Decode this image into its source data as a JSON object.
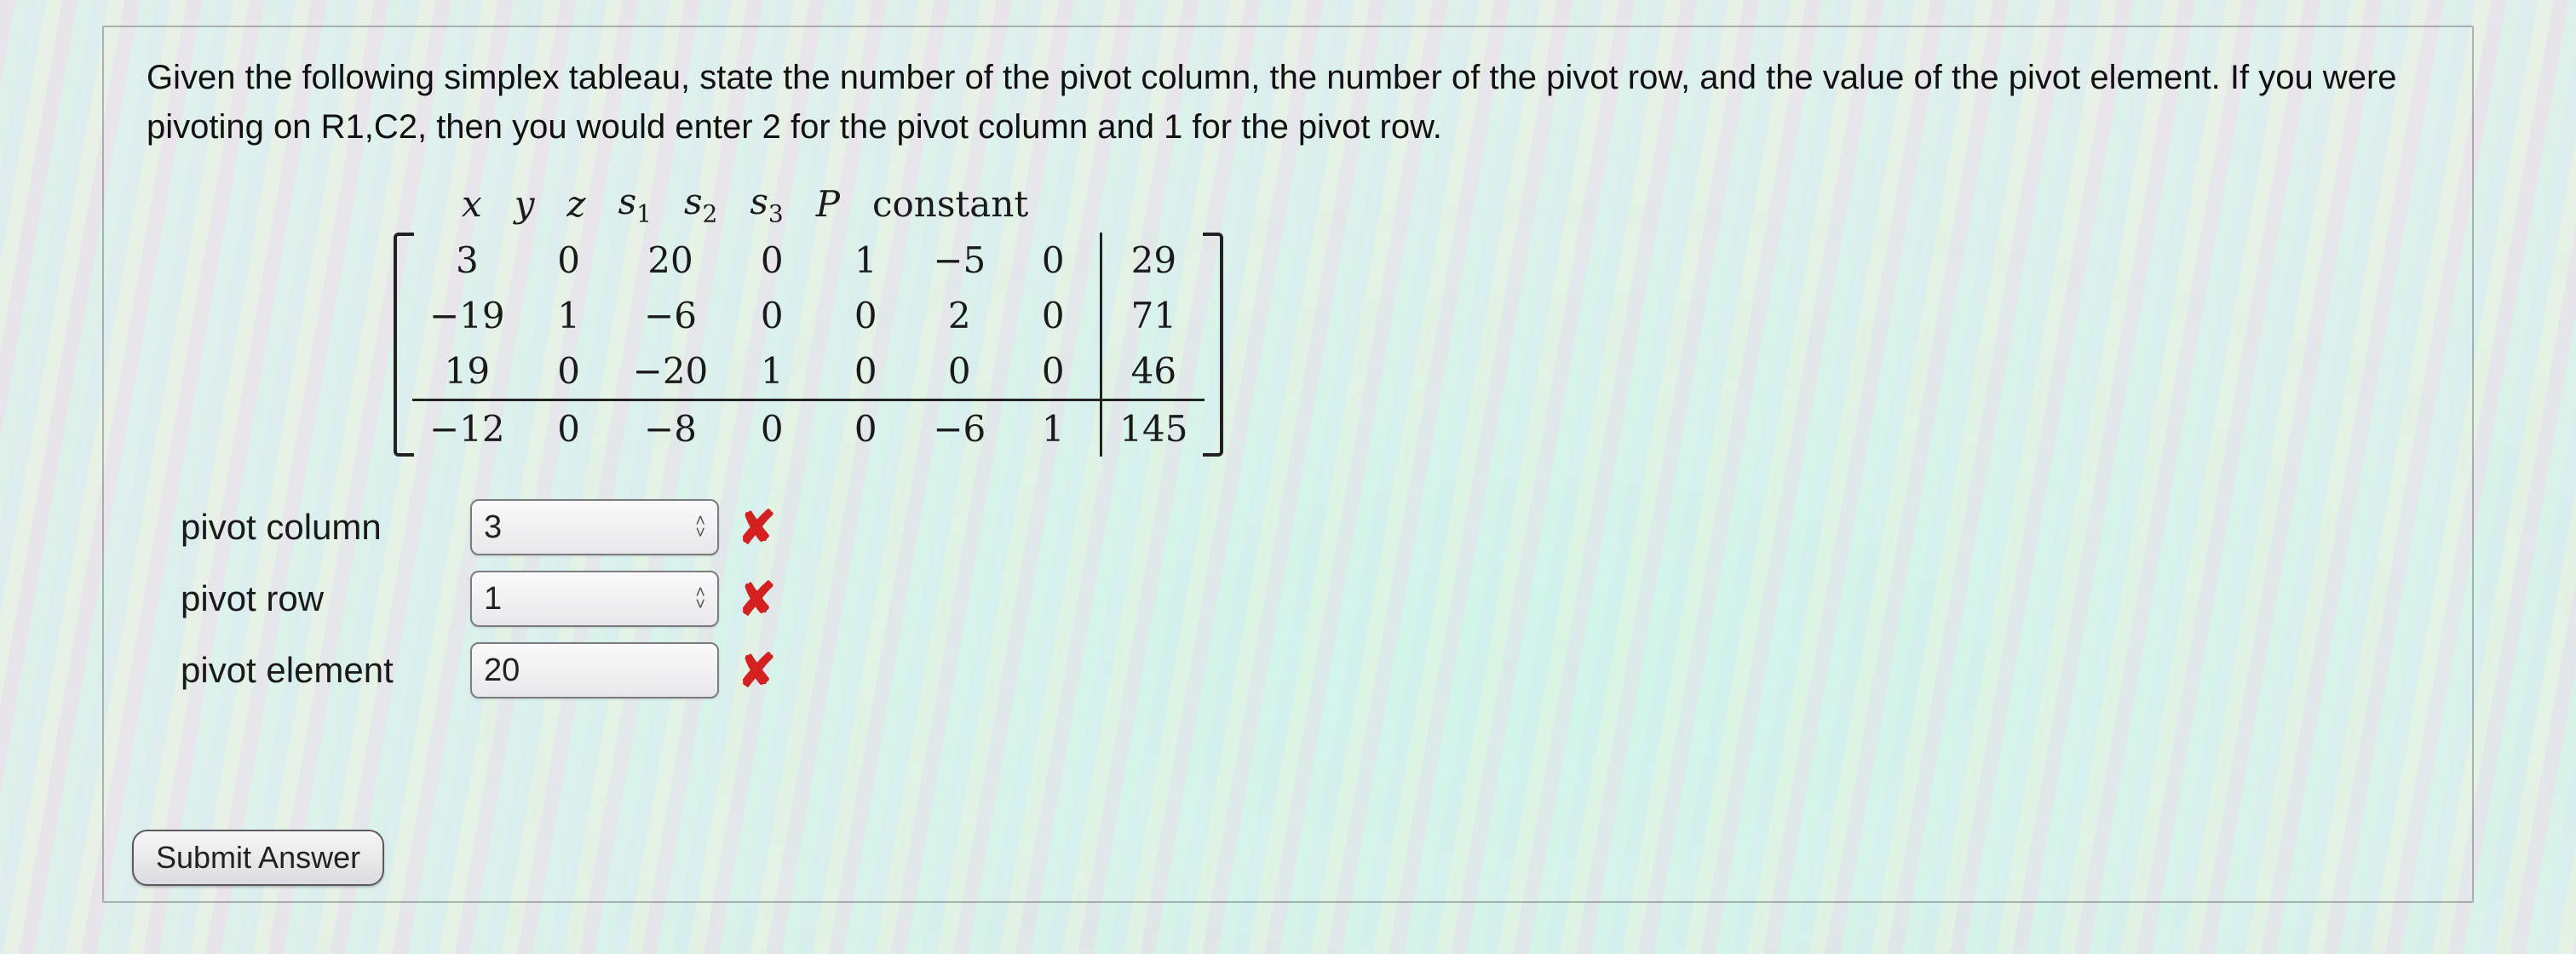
{
  "question": "Given the following simplex tableau, state the number of the pivot column, the number of the pivot row, and the value of the pivot element. If you were pivoting on R1,C2, then you would enter 2 for the pivot column and 1 for the pivot row.",
  "headers": {
    "x": "x",
    "y": "y",
    "z": "z",
    "s1": "s",
    "s1sub": "1",
    "s2": "s",
    "s2sub": "2",
    "s3": "s",
    "s3sub": "3",
    "P": "P",
    "const": "constant"
  },
  "rows": [
    {
      "x": "3",
      "y": "0",
      "z": "20",
      "s1": "0",
      "s2": "1",
      "s3": "−5",
      "P": "0",
      "c": "29"
    },
    {
      "x": "−19",
      "y": "1",
      "z": "−6",
      "s1": "0",
      "s2": "0",
      "s3": "2",
      "P": "0",
      "c": "71"
    },
    {
      "x": "19",
      "y": "0",
      "z": "−20",
      "s1": "1",
      "s2": "0",
      "s3": "0",
      "P": "0",
      "c": "46"
    },
    {
      "x": "−12",
      "y": "0",
      "z": "−8",
      "s1": "0",
      "s2": "0",
      "s3": "−6",
      "P": "1",
      "c": "145"
    }
  ],
  "answers": {
    "pivot_column": {
      "label": "pivot column",
      "value": "3",
      "status": "wrong"
    },
    "pivot_row": {
      "label": "pivot row",
      "value": "1",
      "status": "wrong"
    },
    "pivot_element": {
      "label": "pivot element",
      "value": "20",
      "status": "wrong"
    }
  },
  "icons": {
    "x": "✘",
    "up": "˄",
    "down": "˅"
  },
  "submit_label": "Submit Answer",
  "chart_data": {
    "type": "table",
    "title": "Simplex tableau",
    "columns": [
      "x",
      "y",
      "z",
      "s1",
      "s2",
      "s3",
      "P",
      "constant"
    ],
    "rows": [
      [
        3,
        0,
        20,
        0,
        1,
        -5,
        0,
        29
      ],
      [
        -19,
        1,
        -6,
        0,
        0,
        2,
        0,
        71
      ],
      [
        19,
        0,
        -20,
        1,
        0,
        0,
        0,
        46
      ],
      [
        -12,
        0,
        -8,
        0,
        0,
        -6,
        1,
        145
      ]
    ],
    "note": "Last row is objective row (separated by horizontal rule); vertical rule before 'constant' column."
  }
}
